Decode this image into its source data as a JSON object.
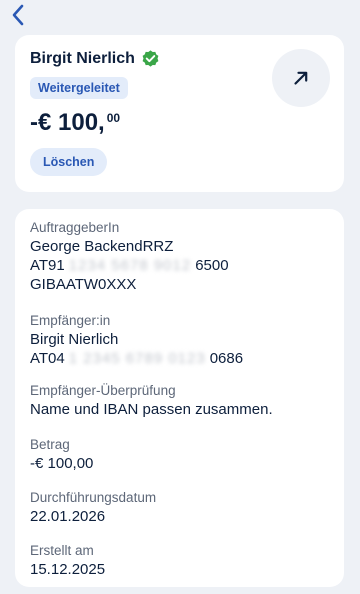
{
  "nav": {
    "back_icon": "chevron-left-icon"
  },
  "header": {
    "recipient_name": "Birgit Nierlich",
    "verified_icon": "verified-check-icon",
    "status_badge": "Weitergeleitet",
    "amount_main": "-€ 100,",
    "amount_cents": "00",
    "delete_label": "Löschen",
    "open_icon": "arrow-up-right-icon"
  },
  "details": {
    "originator": {
      "label": "AuftraggeberIn",
      "name": "George BackendRRZ",
      "iban_prefix": "AT91",
      "iban_masked": "1234 5678 9012",
      "iban_suffix": "6500",
      "bic": "GIBAATW0XXX"
    },
    "recipient": {
      "label": "Empfänger:in",
      "name": "Birgit Nierlich",
      "iban_prefix": "AT04",
      "iban_masked": "1 2345 6789 0123",
      "iban_suffix": "0686"
    },
    "verification": {
      "label": "Empfänger-Überprüfung",
      "value": "Name und IBAN passen zusammen."
    },
    "amount": {
      "label": "Betrag",
      "value": "-€ 100,00"
    },
    "execution_date": {
      "label": "Durchführungsdatum",
      "value": "22.01.2026"
    },
    "created": {
      "label": "Erstellt am",
      "value": "15.12.2025"
    }
  },
  "colors": {
    "background": "#eef1f6",
    "card": "#ffffff",
    "accent": "#2a58b4",
    "verified": "#3aa648",
    "text": "#0d1f3c",
    "muted": "#5d6778"
  }
}
